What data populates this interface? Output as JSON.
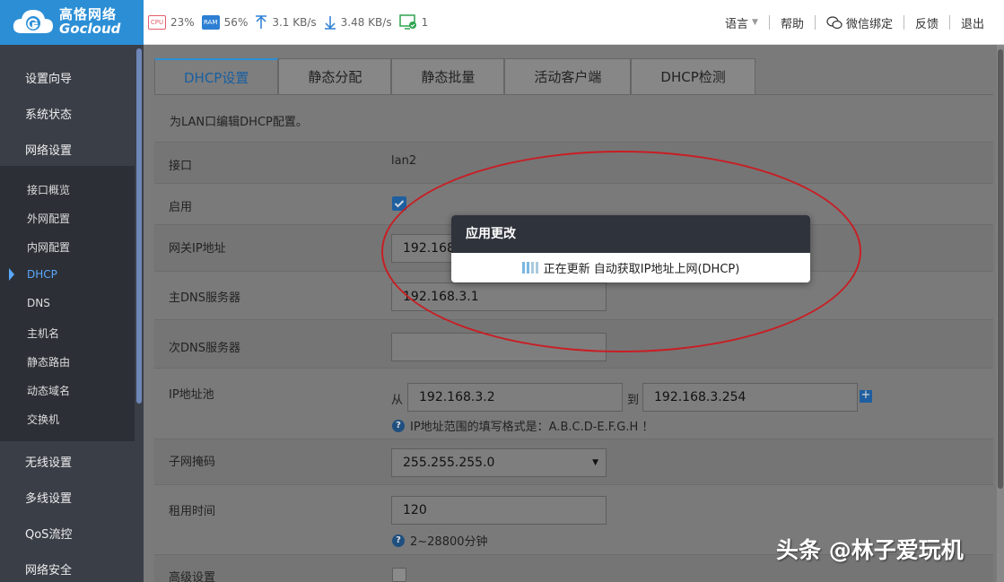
{
  "header": {
    "brand_cn": "高恪网络",
    "brand_en": "Gocloud",
    "stats": {
      "cpu_label": "CPU",
      "cpu_value": "23%",
      "ram_label": "RAM",
      "ram_value": "56%",
      "upload": "3.1 KB/s",
      "download": "3.48 KB/s",
      "devices": "1"
    },
    "nav": {
      "language": "语言",
      "help": "帮助",
      "wechat": "微信绑定",
      "feedback": "反馈",
      "logout": "退出"
    }
  },
  "sidebar": {
    "top_items": [
      "设置向导",
      "系统状态",
      "网络设置"
    ],
    "sub_items": [
      "接口概览",
      "外网配置",
      "内网配置",
      "DHCP",
      "DNS",
      "主机名",
      "静态路由",
      "动态域名",
      "交换机"
    ],
    "bottom_items": [
      "无线设置",
      "多线设置",
      "QoS流控",
      "网络安全"
    ],
    "active": "DHCP"
  },
  "tabs": [
    "DHCP设置",
    "静态分配",
    "静态批量",
    "活动客户端",
    "DHCP检测"
  ],
  "form": {
    "description": "为LAN口编辑DHCP配置。",
    "interface_label": "接口",
    "interface_value": "lan2",
    "enable_label": "启用",
    "gateway_label": "网关IP地址",
    "gateway_value": "192.168",
    "dns1_label": "主DNS服务器",
    "dns1_value": "192.168.3.1",
    "dns2_label": "次DNS服务器",
    "dns2_value": "",
    "pool_label": "IP地址池",
    "pool_from": "从",
    "pool_start": "192.168.3.2",
    "pool_to": "到",
    "pool_end": "192.168.3.254",
    "pool_hint": "IP地址范围的填写格式是：A.B.C.D-E.F.G.H ！",
    "mask_label": "子网掩码",
    "mask_value": "255.255.255.0",
    "lease_label": "租用时间",
    "lease_value": "120",
    "lease_hint": "2~28800分钟",
    "advanced_label": "高级设置"
  },
  "modal": {
    "title": "应用更改",
    "message": "正在更新 自动获取IP地址上网(DHCP)"
  },
  "watermark": "头条 @林子爱玩机"
}
